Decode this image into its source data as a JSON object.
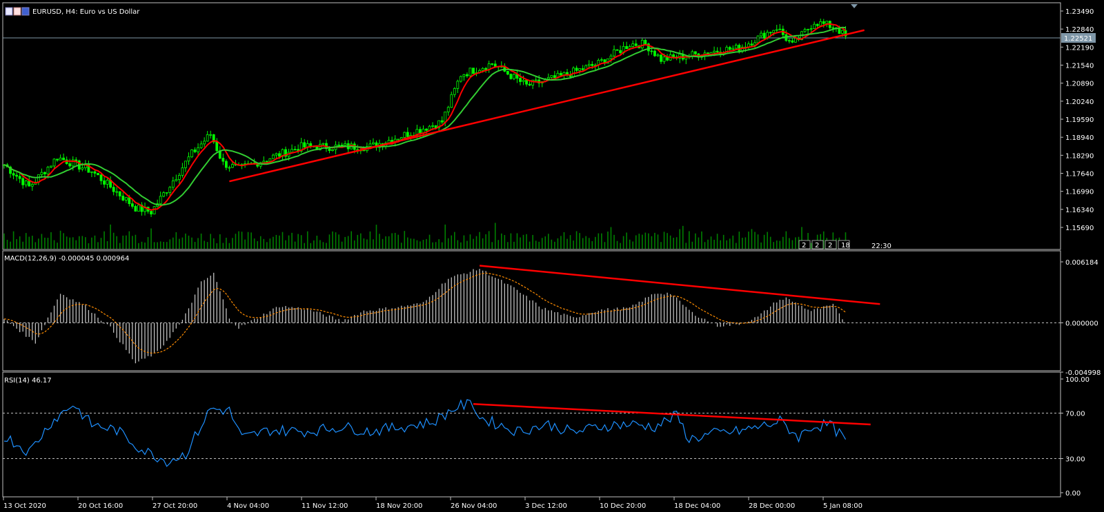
{
  "window": {
    "title": "EURUSD, H4:  Euro vs US Dollar",
    "timer_label": "22:30",
    "timer_markers": [
      "2",
      "2",
      "2",
      "18"
    ]
  },
  "colors": {
    "background": "#000000",
    "grid": "#bfbfbf",
    "candle": "#00ff00",
    "ma_fast": "#ff0000",
    "ma_slow": "#32cd32",
    "volume": "#008000",
    "macd_hist": "#c0c0c0",
    "macd_signal": "#ff8c00",
    "rsi_line": "#1e90ff",
    "trendline": "#ff0000"
  },
  "chart_data": [
    {
      "type": "candlestick",
      "title": "EURUSD, H4:  Euro vs US Dollar",
      "symbol": "EURUSD",
      "timeframe": "H4",
      "current_price_label": "1.22521",
      "ylim": [
        1.1569,
        1.2349
      ],
      "y_ticks": [
        "1.23490",
        "1.22840",
        "1.22190",
        "1.21540",
        "1.20890",
        "1.20240",
        "1.19590",
        "1.18940",
        "1.18290",
        "1.17640",
        "1.16990",
        "1.16340",
        "1.15690"
      ],
      "x_ticks": [
        "13 Oct 2020",
        "20 Oct 16:00",
        "27 Oct 20:00",
        "4 Nov 04:00",
        "11 Nov 12:00",
        "18 Nov 20:00",
        "26 Nov 04:00",
        "3 Dec 12:00",
        "10 Dec 20:00",
        "18 Dec 04:00",
        "28 Dec 00:00",
        "5 Jan 08:00"
      ],
      "price_path": [
        [
          0,
          1.1795
        ],
        [
          8,
          1.1715
        ],
        [
          17,
          1.1822
        ],
        [
          28,
          1.1772
        ],
        [
          42,
          1.164
        ],
        [
          47,
          1.1625
        ],
        [
          60,
          1.1835
        ],
        [
          66,
          1.1905
        ],
        [
          70,
          1.18
        ],
        [
          75,
          1.178
        ],
        [
          95,
          1.186
        ],
        [
          117,
          1.186
        ],
        [
          140,
          1.195
        ],
        [
          146,
          1.212
        ],
        [
          156,
          1.216
        ],
        [
          167,
          1.208
        ],
        [
          177,
          1.211
        ],
        [
          190,
          1.216
        ],
        [
          200,
          1.223
        ],
        [
          205,
          1.223
        ],
        [
          210,
          1.2175
        ],
        [
          217,
          1.2185
        ],
        [
          230,
          1.221
        ],
        [
          235,
          1.2215
        ],
        [
          247,
          1.229
        ],
        [
          252,
          1.2225
        ],
        [
          259,
          1.231
        ],
        [
          266,
          1.229
        ],
        [
          269,
          1.2255
        ]
      ],
      "trendlines": [
        {
          "from": [
            72,
            1.1735
          ],
          "to": [
            275,
            1.228
          ]
        }
      ],
      "moving_averages": [
        {
          "color": "ma_fast",
          "smoothing": 6
        },
        {
          "color": "ma_slow",
          "smoothing": 14
        }
      ],
      "volume": true
    },
    {
      "type": "histogram",
      "indicator": "MACD(12,26,9) -0.000045 0.000964",
      "ylim": [
        -0.004998,
        0.006184
      ],
      "y_ticks": [
        "0.006184",
        "0.000000",
        "-0.004998"
      ],
      "hist_path": [
        [
          0,
          0.0004
        ],
        [
          10,
          -0.002
        ],
        [
          18,
          0.003
        ],
        [
          26,
          0.0017
        ],
        [
          34,
          -0.0005
        ],
        [
          42,
          -0.0041
        ],
        [
          49,
          -0.003
        ],
        [
          57,
          0.0002
        ],
        [
          63,
          0.0041
        ],
        [
          67,
          0.005
        ],
        [
          72,
          0.0005
        ],
        [
          75,
          -0.0005
        ],
        [
          88,
          0.0017
        ],
        [
          97,
          0.0014
        ],
        [
          108,
          0.0002
        ],
        [
          115,
          0.0012
        ],
        [
          126,
          0.0016
        ],
        [
          134,
          0.002
        ],
        [
          142,
          0.0045
        ],
        [
          152,
          0.0055
        ],
        [
          163,
          0.0035
        ],
        [
          172,
          0.0015
        ],
        [
          182,
          0.0005
        ],
        [
          190,
          0.0013
        ],
        [
          200,
          0.0015
        ],
        [
          208,
          0.003
        ],
        [
          213,
          0.003
        ],
        [
          220,
          0.001
        ],
        [
          228,
          -0.0003
        ],
        [
          234,
          -0.0002
        ],
        [
          241,
          0.0006
        ],
        [
          247,
          0.0022
        ],
        [
          250,
          0.0025
        ],
        [
          258,
          0.0012
        ],
        [
          265,
          0.0018
        ],
        [
          269,
          0.0
        ]
      ],
      "trendlines": [
        {
          "from": [
            152,
            0.0058
          ],
          "to": [
            280,
            0.0019
          ]
        }
      ]
    },
    {
      "type": "line",
      "indicator": "RSI(14) 46.17",
      "ylim": [
        0,
        100
      ],
      "y_ticks": [
        "100.00",
        "70.00",
        "30.00",
        "0.00"
      ],
      "levels": [
        70,
        30
      ],
      "rsi_path": [
        [
          0,
          50
        ],
        [
          8,
          36
        ],
        [
          15,
          62
        ],
        [
          22,
          78
        ],
        [
          28,
          60
        ],
        [
          36,
          55
        ],
        [
          44,
          38
        ],
        [
          52,
          28
        ],
        [
          58,
          34
        ],
        [
          66,
          74
        ],
        [
          72,
          72
        ],
        [
          76,
          48
        ],
        [
          85,
          55
        ],
        [
          97,
          54
        ],
        [
          108,
          58
        ],
        [
          117,
          54
        ],
        [
          127,
          58
        ],
        [
          137,
          62
        ],
        [
          145,
          76
        ],
        [
          150,
          78
        ],
        [
          152,
          66
        ],
        [
          164,
          54
        ],
        [
          174,
          60
        ],
        [
          182,
          53
        ],
        [
          190,
          58
        ],
        [
          196,
          60
        ],
        [
          202,
          60
        ],
        [
          208,
          58
        ],
        [
          215,
          68
        ],
        [
          219,
          47
        ],
        [
          227,
          52
        ],
        [
          235,
          54
        ],
        [
          243,
          59
        ],
        [
          248,
          63
        ],
        [
          254,
          49
        ],
        [
          258,
          58
        ],
        [
          264,
          60
        ],
        [
          269,
          46
        ]
      ],
      "trendlines": [
        {
          "from": [
            150,
            78
          ],
          "to": [
            277,
            60
          ]
        }
      ]
    }
  ]
}
